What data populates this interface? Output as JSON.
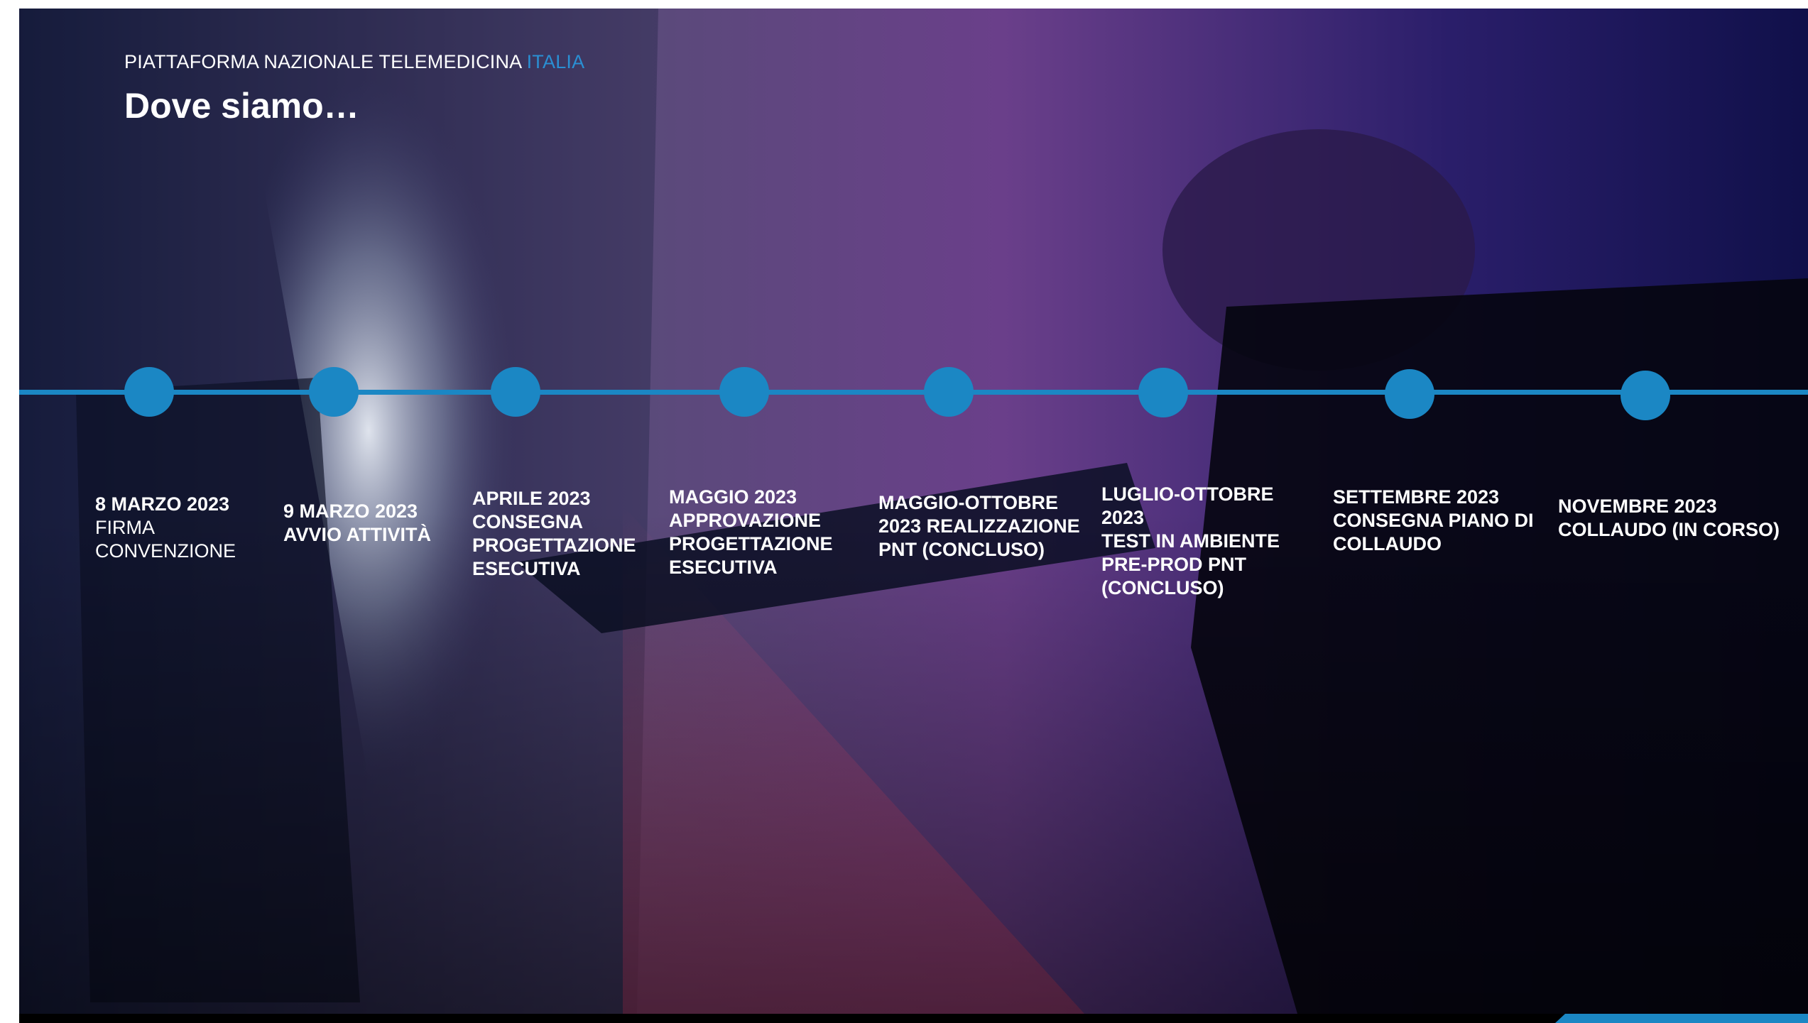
{
  "header": {
    "platform": "PIATTAFORMA NAZIONALE TELEMEDICINA",
    "platform_accent": "ITALIA",
    "title": "Dove siamo…"
  },
  "colors": {
    "accent": "#1b87c4",
    "text": "#ffffff"
  },
  "milestones": [
    {
      "date": "8 MARZO 2023",
      "desc": "FIRMA CONVENZIONE",
      "desc_bold": false
    },
    {
      "date": "9 MARZO 2023",
      "desc": "AVVIO ATTIVITÀ",
      "desc_bold": true
    },
    {
      "date": "APRILE  2023",
      "desc": "CONSEGNA PROGETTAZIONE ESECUTIVA",
      "desc_bold": true
    },
    {
      "date": "MAGGIO 2023",
      "desc": "APPROVAZIONE PROGETTAZIONE ESECUTIVA",
      "desc_bold": true
    },
    {
      "date": "MAGGIO-OTTOBRE 2023",
      "desc": "REALIZZAZIONE PNT (CONCLUSO)",
      "desc_bold": true
    },
    {
      "date": "LUGLIO-OTTOBRE 2023",
      "desc": "TEST IN AMBIENTE PRE-PROD PNT (CONCLUSO)",
      "desc_bold": true
    },
    {
      "date": "SETTEMBRE 2023",
      "desc": "CONSEGNA PIANO DI COLLAUDO",
      "desc_bold": true
    },
    {
      "date": "NOVEMBRE 2023",
      "desc": "COLLAUDO (IN CORSO)",
      "desc_bold": true
    }
  ],
  "background_image": "person-with-flashlight-photo"
}
